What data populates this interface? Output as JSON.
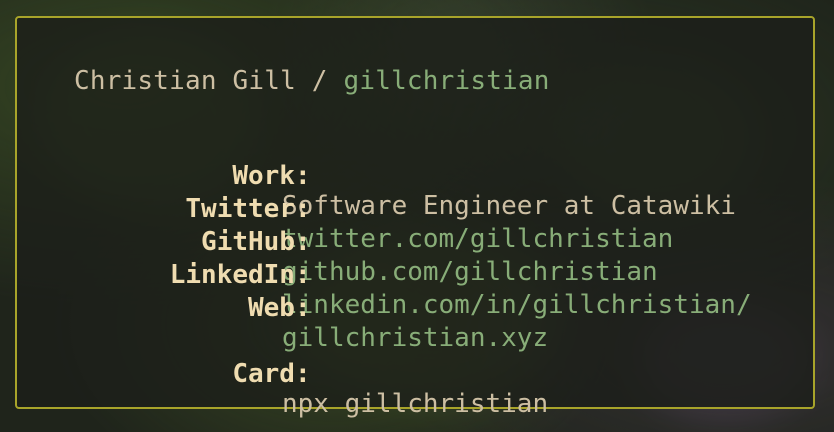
{
  "card": {
    "name": "Christian Gill",
    "separator": " / ",
    "handle": "gillchristian",
    "rows": [
      {
        "label": "Work:",
        "value": "Software Engineer at Catawiki"
      },
      {
        "label": "Twitter:",
        "value": "twitter.com/gillchristian"
      },
      {
        "label": "GitHub:",
        "value": "github.com/gillchristian"
      },
      {
        "label": "LinkedIn:",
        "value": "linkedin.com/in/gillchristian/"
      },
      {
        "label": "Web:",
        "value": "gillchristian.xyz"
      },
      {
        "label": "Card:",
        "value": "npx gillchristian"
      }
    ]
  },
  "colors": {
    "border": "#a8a42a",
    "label": "#efdcb0",
    "text": "#cdbfa3",
    "link": "#88ad78"
  }
}
